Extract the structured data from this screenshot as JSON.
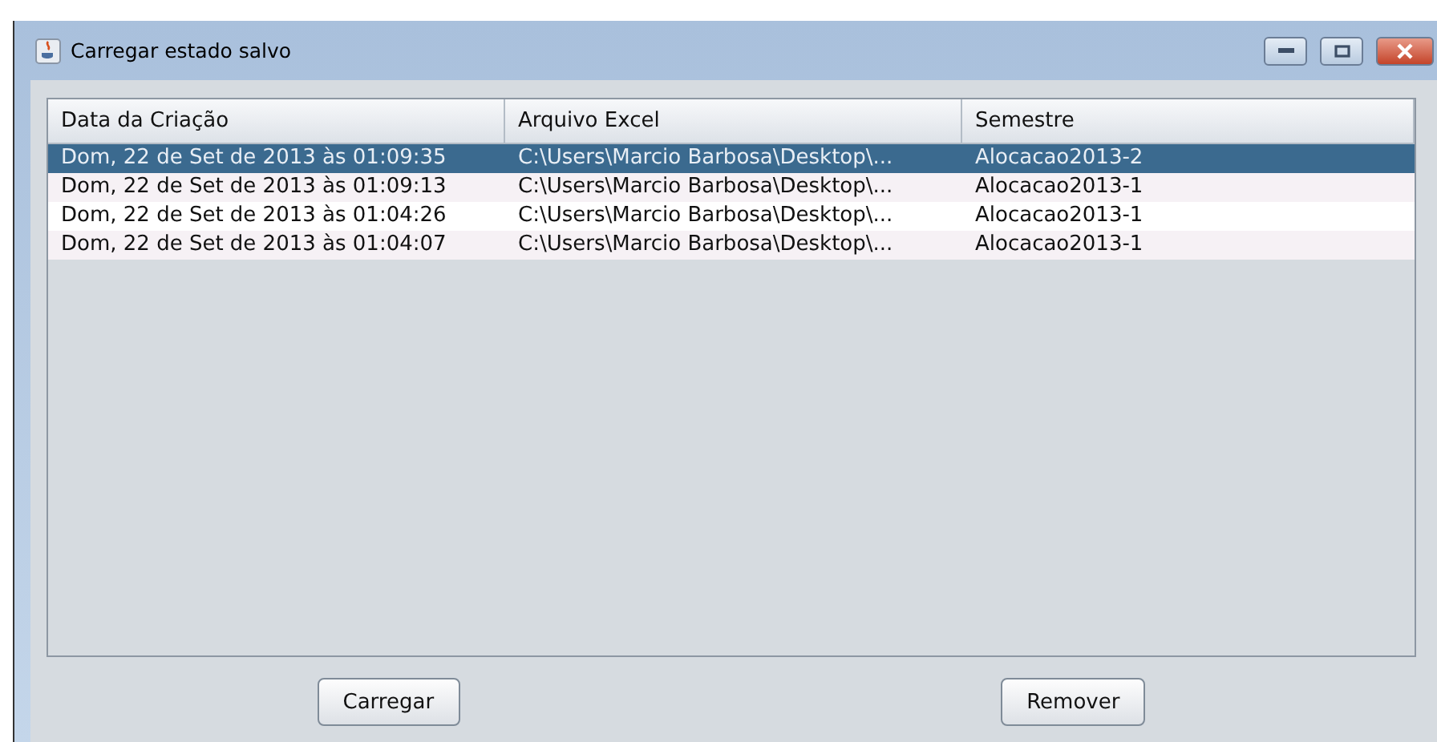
{
  "window": {
    "title": "Carregar estado salvo"
  },
  "table": {
    "columns": [
      "Data da Criação",
      "Arquivo Excel",
      "Semestre"
    ],
    "rows": [
      {
        "selected": true,
        "cells": [
          "Dom, 22 de Set de 2013 às 01:09:35",
          "C:\\Users\\Marcio Barbosa\\Desktop\\...",
          "Alocacao2013-2"
        ]
      },
      {
        "selected": false,
        "cells": [
          "Dom, 22 de Set de 2013 às 01:09:13",
          "C:\\Users\\Marcio Barbosa\\Desktop\\...",
          "Alocacao2013-1"
        ]
      },
      {
        "selected": false,
        "cells": [
          "Dom, 22 de Set de 2013 às 01:04:26",
          "C:\\Users\\Marcio Barbosa\\Desktop\\...",
          "Alocacao2013-1"
        ]
      },
      {
        "selected": false,
        "cells": [
          "Dom, 22 de Set de 2013 às 01:04:07",
          "C:\\Users\\Marcio Barbosa\\Desktop\\...",
          "Alocacao2013-1"
        ]
      }
    ]
  },
  "buttons": [
    "Carregar",
    "Remover"
  ]
}
